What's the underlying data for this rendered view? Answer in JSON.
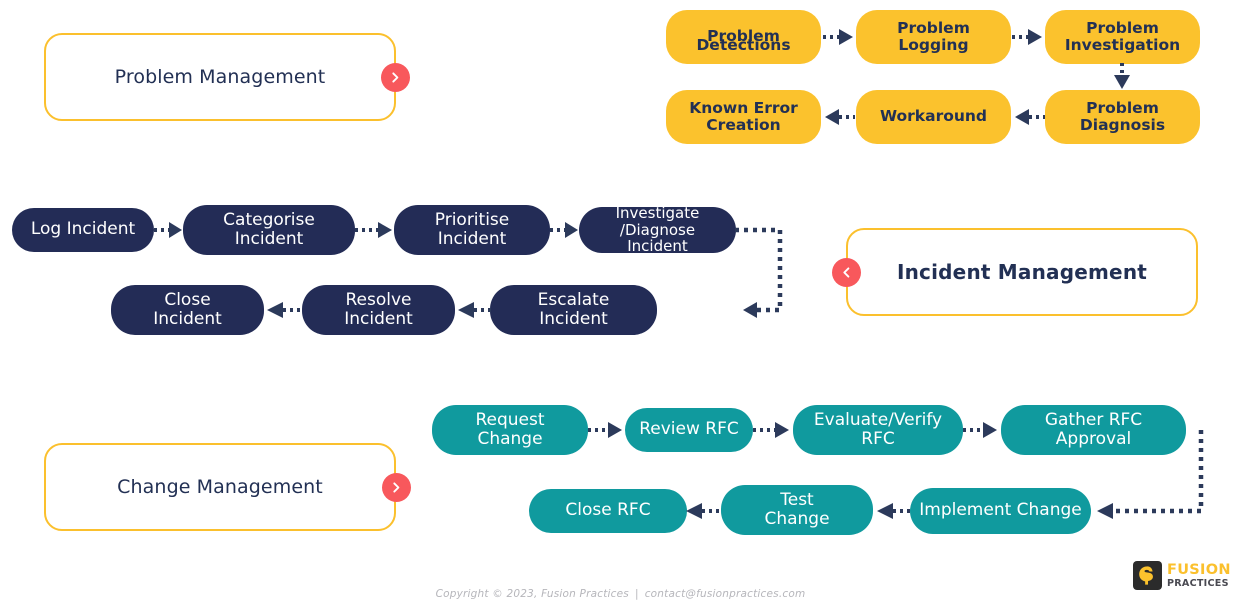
{
  "colors": {
    "yellow": "#FBC22D",
    "navy": "#232C56",
    "teal": "#109A9E",
    "red_badge": "#F8585C",
    "card_border": "#FBC02D",
    "footer_text": "#b6b6bb"
  },
  "sections": {
    "problem": {
      "card_label": "Problem Management",
      "badge_icon": "chevron-right-icon",
      "steps": [
        {
          "label": "Problem Detections",
          "lines": [
            "Problem",
            "Detections"
          ]
        },
        {
          "label": "Problem Logging",
          "lines": [
            "Problem",
            "Logging"
          ]
        },
        {
          "label": "Problem Investigation",
          "lines": [
            "Problem",
            "Investigation"
          ]
        },
        {
          "label": "Problem Diagnosis",
          "lines": [
            "Problem",
            "Diagnosis"
          ]
        },
        {
          "label": "Workaround",
          "lines": [
            "Workaround"
          ]
        },
        {
          "label": "Known Error Creation",
          "lines": [
            "Known Error",
            "Creation"
          ]
        }
      ]
    },
    "incident": {
      "card_label": "Incident Management",
      "badge_icon": "chevron-left-icon",
      "steps": [
        {
          "label": "Log Incident",
          "lines": [
            "Log Incident"
          ]
        },
        {
          "label": "Categorise Incident",
          "lines": [
            "Categorise",
            "Incident"
          ]
        },
        {
          "label": "Prioritise Incident",
          "lines": [
            "Prioritise",
            "Incident"
          ]
        },
        {
          "label": "Investigate /Diagnose Incident",
          "lines": [
            "Investigate",
            "/Diagnose Incident"
          ]
        },
        {
          "label": "Escalate Incident",
          "lines": [
            "Escalate",
            "Incident"
          ]
        },
        {
          "label": "Resolve Incident",
          "lines": [
            "Resolve",
            "Incident"
          ]
        },
        {
          "label": "Close Incident",
          "lines": [
            "Close",
            "Incident"
          ]
        }
      ]
    },
    "change": {
      "card_label": "Change Management",
      "badge_icon": "chevron-right-icon",
      "steps": [
        {
          "label": "Request Change",
          "lines": [
            "Request",
            "Change"
          ]
        },
        {
          "label": "Review RFC",
          "lines": [
            "Review RFC"
          ]
        },
        {
          "label": "Evaluate/Verify RFC",
          "lines": [
            "Evaluate/Verify",
            "RFC"
          ]
        },
        {
          "label": "Gather RFC Approval",
          "lines": [
            "Gather RFC",
            "Approval"
          ]
        },
        {
          "label": "Implement Change",
          "lines": [
            "Implement Change"
          ]
        },
        {
          "label": "Test Change",
          "lines": [
            "Test",
            "Change"
          ]
        },
        {
          "label": "Close RFC",
          "lines": [
            "Close RFC"
          ]
        }
      ]
    }
  },
  "footer": {
    "copyright": "Copyright © 2023, Fusion Practices",
    "separator": "|",
    "email": "contact@fusionpractices.com"
  },
  "logo": {
    "mark_icon": "fusion-f-mark-icon",
    "primary": "FUSION",
    "secondary": "PRACTICES"
  }
}
